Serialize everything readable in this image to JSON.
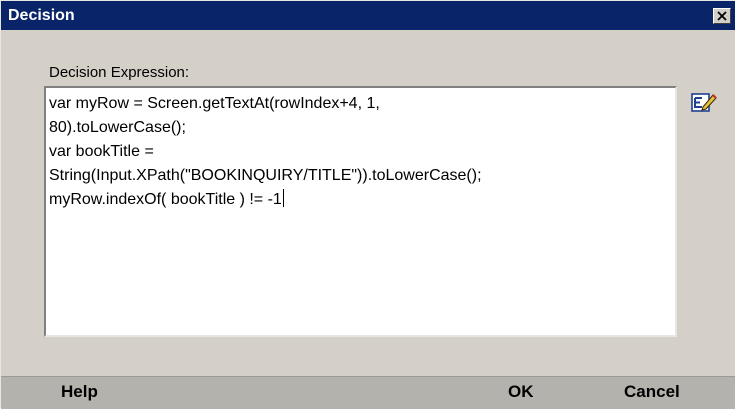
{
  "window": {
    "title": "Decision",
    "close_symbol": "×"
  },
  "form": {
    "expression_label": "Decision Expression:",
    "expression_lines": [
      "var myRow = Screen.getTextAt(rowIndex+4, 1,",
      "80).toLowerCase();",
      "var bookTitle =",
      "String(Input.XPath(\"BOOKINQUIRY/TITLE\")).toLowerCase();",
      "myRow.indexOf( bookTitle ) != -1"
    ]
  },
  "buttons": {
    "help": "Help",
    "ok": "OK",
    "cancel": "Cancel"
  },
  "icons": {
    "close": "close-icon",
    "edit": "edit-expression-icon"
  },
  "colors": {
    "title_bar": "#0a246a",
    "dialog_bg": "#d4d0c8",
    "button_bar": "#b4b2ac"
  }
}
